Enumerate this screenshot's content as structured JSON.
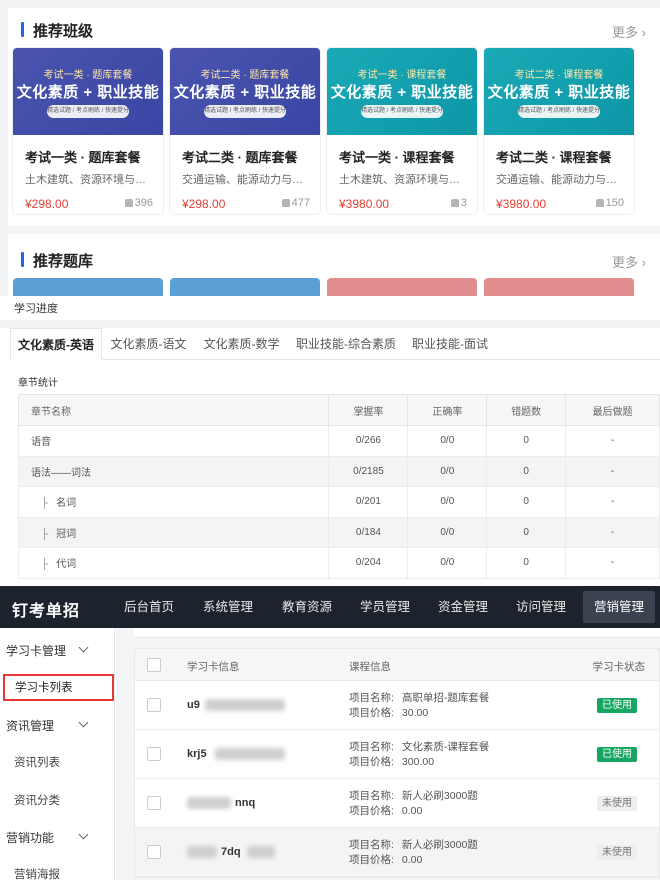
{
  "recommended_classes": {
    "title": "推荐班级",
    "more": "更多",
    "cards": [
      {
        "banner_top": "考试一类 · 题库套餐",
        "banner_main": "文化素质 + 职业技能",
        "banner_pill": "精选试题 / 考点刷练 / 快速提分",
        "theme": "blue",
        "title": "考试一类 · 题库套餐",
        "subtitle": "土木建筑、资源环境与安…",
        "price": "¥298.00",
        "likes": "396"
      },
      {
        "banner_top": "考试二类 · 题库套餐",
        "banner_main": "文化素质 + 职业技能",
        "banner_pill": "精选试题 / 考点刷练 / 快速提分",
        "theme": "blue",
        "title": "考试二类 · 题库套餐",
        "subtitle": "交通运输、能源动力与材…",
        "price": "¥298.00",
        "likes": "477"
      },
      {
        "banner_top": "考试一类 · 课程套餐",
        "banner_main": "文化素质 + 职业技能",
        "banner_pill": "精选试题 / 考点刷练 / 快速提分",
        "theme": "teal",
        "title": "考试一类 · 课程套餐",
        "subtitle": "土木建筑、资源环境与安…",
        "price": "¥3980.00",
        "likes": "3"
      },
      {
        "banner_top": "考试二类 · 课程套餐",
        "banner_main": "文化素质 + 职业技能",
        "banner_pill": "精选试题 / 考点刷练 / 快速提分",
        "theme": "teal",
        "title": "考试二类 · 课程套餐",
        "subtitle": "交通运输、能源动力与材…",
        "price": "¥3980.00",
        "likes": "150"
      }
    ]
  },
  "recommended_banks": {
    "title": "推荐题库",
    "more": "更多",
    "stub_colors": [
      "#5ba0d4",
      "#5ba0d4",
      "#e28e8e",
      "#e28e8e"
    ]
  },
  "progress": {
    "page_label": "学习进度",
    "tabs": [
      "文化素质-英语",
      "文化素质-语文",
      "文化素质-数学",
      "职业技能-综合素质",
      "职业技能-面试"
    ],
    "active_tab": 0,
    "stats_label": "章节统计",
    "columns": [
      "章节名称",
      "掌握率",
      "正确率",
      "错题数",
      "最后做题"
    ],
    "rows": [
      {
        "name": "语音",
        "mastery": "0/266",
        "accuracy": "0/0",
        "wrong": "0",
        "last": "-",
        "indent": false
      },
      {
        "name": "语法——词法",
        "mastery": "0/2185",
        "accuracy": "0/0",
        "wrong": "0",
        "last": "-",
        "indent": false
      },
      {
        "name": "名词",
        "mastery": "0/201",
        "accuracy": "0/0",
        "wrong": "0",
        "last": "-",
        "indent": true
      },
      {
        "name": "冠词",
        "mastery": "0/184",
        "accuracy": "0/0",
        "wrong": "0",
        "last": "-",
        "indent": true
      },
      {
        "name": "代词",
        "mastery": "0/204",
        "accuracy": "0/0",
        "wrong": "0",
        "last": "-",
        "indent": true
      }
    ],
    "tree_glyph": "├"
  },
  "admin": {
    "logo": "钉考单招",
    "nav": [
      "后台首页",
      "系统管理",
      "教育资源",
      "学员管理",
      "资金管理",
      "访问管理",
      "营销管理"
    ],
    "active_nav": 6,
    "sidebar": {
      "groups": [
        "学习卡管理",
        "资讯管理",
        "营销功能"
      ],
      "items": [
        "学习卡列表",
        "资讯列表",
        "资讯分类",
        "营销海报"
      ]
    },
    "table": {
      "columns": [
        "学习卡信息",
        "课程信息",
        "学习卡状态"
      ],
      "label_name": "项目名称:",
      "label_price": "项目价格:",
      "rows": [
        {
          "card_prefix": "u9",
          "project_name": "高职单招-题库套餐",
          "project_price": "30.00",
          "status": "已使用",
          "used": true
        },
        {
          "card_prefix": "krj5",
          "project_name": "文化素质-课程套餐",
          "project_price": "300.00",
          "status": "已使用",
          "used": true
        },
        {
          "card_prefix": "nnq",
          "project_name": "新人必刷3000题",
          "project_price": "0.00",
          "status": "未使用",
          "used": false
        },
        {
          "card_prefix": "7dq",
          "project_name": "新人必刷3000题",
          "project_price": "0.00",
          "status": "未使用",
          "used": false
        }
      ]
    }
  }
}
